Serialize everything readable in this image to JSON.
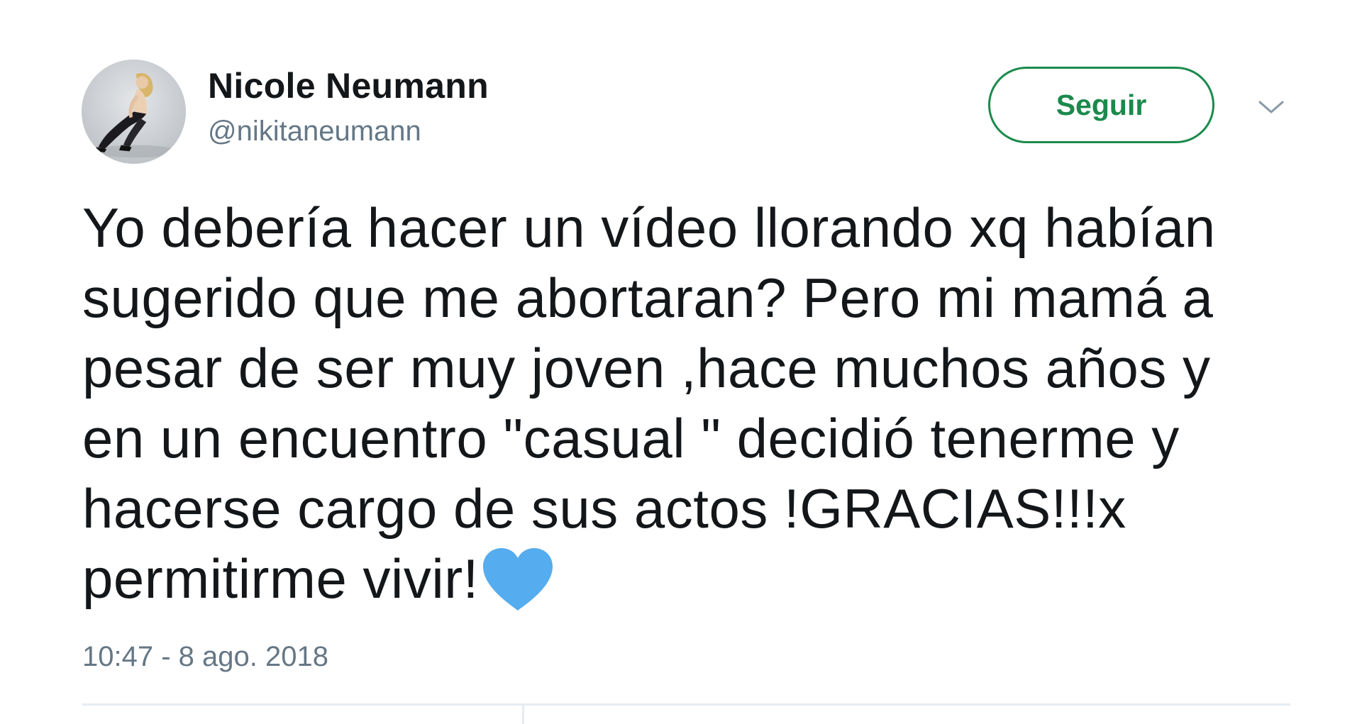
{
  "user": {
    "display_name": "Nicole Neumann",
    "handle": "@nikitaneumann",
    "avatar": "profile-photo"
  },
  "follow_button": {
    "label": "Seguir",
    "color": "#1b8a4c"
  },
  "menu": {
    "icon": "chevron-down-icon"
  },
  "tweet": {
    "lines": [
      "Yo debería hacer un vídeo llorando xq habían",
      "sugerido que me abortaran? Pero mi mamá a",
      "pesar de ser muy joven ,hace muchos años y",
      "en un encuentro \"casual \" decidió tenerme y",
      "hacerse cargo de sus actos !GRACIAS!!!x",
      "permitirme vivir!"
    ],
    "emoji": "blue-heart-icon",
    "emoji_color": "#55acee",
    "timestamp": "10:47 - 8 ago. 2018"
  },
  "colors": {
    "text": "#14171a",
    "secondary_text": "#657786",
    "divider": "#e6ecf0"
  }
}
